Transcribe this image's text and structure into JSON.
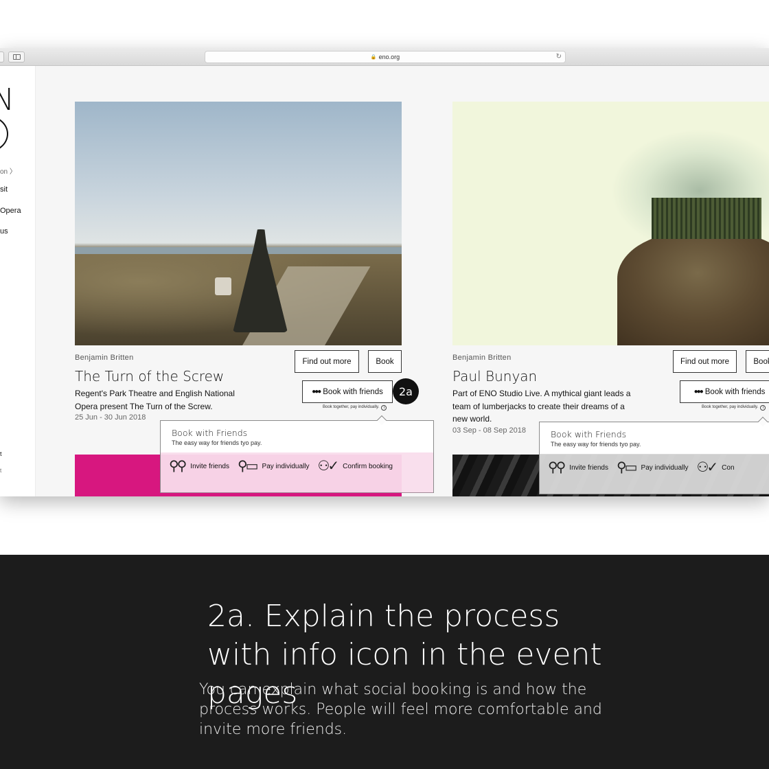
{
  "browser": {
    "address": "eno.org",
    "lock_icon": "lock-icon",
    "reload_icon": "reload-icon"
  },
  "leftnav": {
    "logo_letter": "N",
    "items": [
      "on 〉",
      "sit",
      "Opera",
      "us",
      "t",
      "t"
    ]
  },
  "cards": [
    {
      "composer": "Benjamin Britten",
      "title": "The Turn of the Screw",
      "description": "Regent's Park Theatre and English National Opera present The Turn of the Screw.",
      "dates": "25 Jun - 30 Jun 2018",
      "find_out_more": "Find out more",
      "book": "Book",
      "book_with_friends": "Book with friends",
      "tiny_note": "Book together, pay individually.",
      "badge": "2a",
      "strip_color": "#d7177f"
    },
    {
      "composer": "Benjamin Britten",
      "title": "Paul Bunyan",
      "description": "Part of ENO Studio Live. A mythical giant leads a team of lumberjacks to create their dreams of a new world.",
      "dates": "03 Sep - 08 Sep 2018",
      "find_out_more": "Find out more",
      "book": "Book",
      "book_with_friends": "Book with friends",
      "tiny_note": "Book together, pay individually."
    }
  ],
  "popovers": [
    {
      "title": "Book with Friends",
      "subtitle": "The easy way for friends tyo pay.",
      "steps": [
        {
          "icon": "invite-friends-icon",
          "label": "Invite friends"
        },
        {
          "icon": "pay-individually-icon",
          "label": "Pay individually"
        },
        {
          "icon": "confirm-booking-icon",
          "label": "Confirm booking"
        }
      ]
    },
    {
      "title": "Book with Friends",
      "subtitle": "The easy way for friends tyo pay.",
      "steps": [
        {
          "icon": "invite-friends-icon",
          "label": "Invite friends"
        },
        {
          "icon": "pay-individually-icon",
          "label": "Pay individually"
        },
        {
          "icon": "confirm-booking-icon",
          "label": "Con"
        }
      ]
    }
  ],
  "caption": {
    "heading": "2a. Explain the process with info icon in the event pages",
    "body": "You can explain what social booking is and how the process works. People will feel more comfortable and invite more friends."
  },
  "colors": {
    "caption_bg": "#1c1c1c",
    "accent_pink": "#d7177f",
    "badge_bg": "#111111"
  }
}
